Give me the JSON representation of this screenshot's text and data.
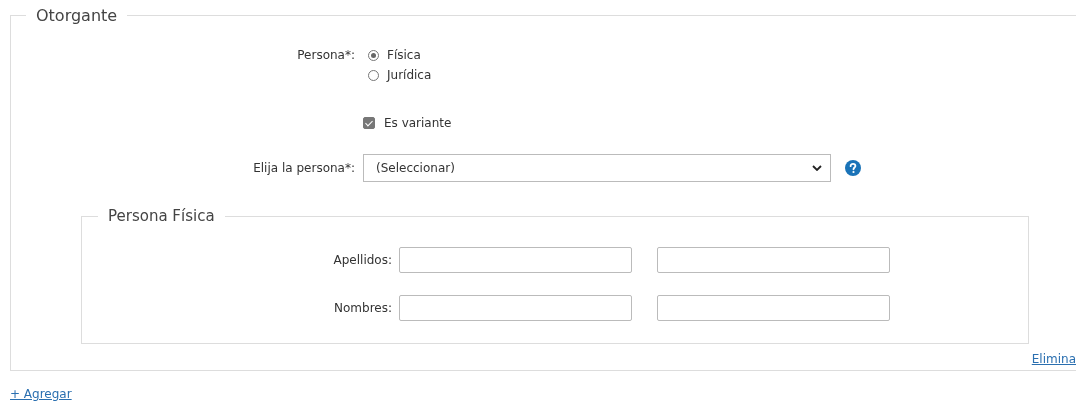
{
  "section": {
    "title": "Otorgante"
  },
  "persona": {
    "label": "Persona*:",
    "options": [
      {
        "label": "Física",
        "selected": true
      },
      {
        "label": "Jurídica",
        "selected": false
      }
    ]
  },
  "variante": {
    "label": "Es variante",
    "checked": true
  },
  "elija": {
    "label": "Elija la persona*:",
    "value": "(Seleccionar)"
  },
  "persona_fisica": {
    "title": "Persona Física",
    "rows": [
      {
        "label": "Apellidos:"
      },
      {
        "label": "Nombres:"
      }
    ]
  },
  "remove_link": "Elimina",
  "add_link": "+ Agregar"
}
